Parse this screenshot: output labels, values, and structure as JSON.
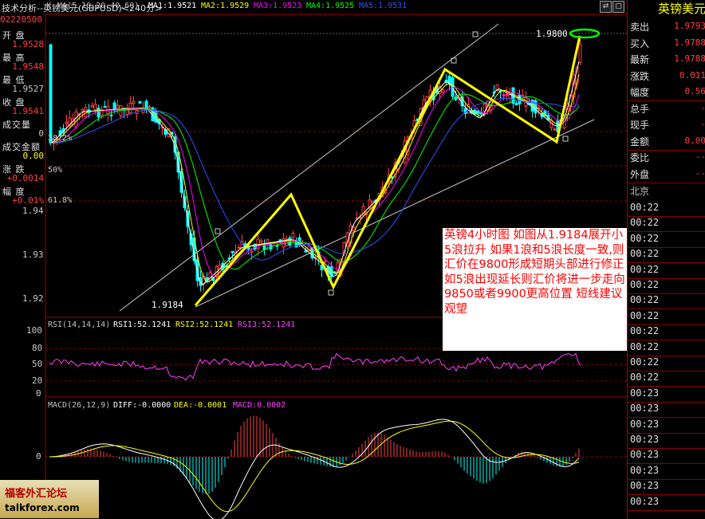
{
  "window": {
    "title": "技术分析--英镑美元(GBPUSD)<240分>",
    "controls": [
      "⇄",
      "▢",
      "▣"
    ]
  },
  "ma_header": {
    "code_k": "K",
    "ma_params": "MA(5,10,20,40,60)",
    "ma1": "MA1:1.9521",
    "ma2": "MA2:1.9529",
    "ma3": "MA3:1.9523",
    "ma4": "MA4:1.9525",
    "ma5": "MA5:1.9531"
  },
  "left_panel": {
    "date": "02220500",
    "items": [
      {
        "label": "开  盘",
        "value": "1.9528",
        "color": "#ff4040"
      },
      {
        "label": "最  高",
        "value": "1.9548",
        "color": "#ff4040"
      },
      {
        "label": "最  低",
        "value": "1.9527",
        "color": "#c8c8c8"
      },
      {
        "label": "收  盘",
        "value": "1.9541",
        "color": "#ff4040"
      },
      {
        "label": "成交量",
        "value": "0",
        "color": "#c8c8c8"
      },
      {
        "label": "成交金额",
        "value": "0.00",
        "color": "#ffff00"
      },
      {
        "label": "涨  跌",
        "value": "+0.0014",
        "color": "#ff4040"
      },
      {
        "label": "幅  度",
        "value": "+0.01%",
        "color": "#ff4040"
      }
    ]
  },
  "price_axis": [
    "1.94",
    "1.93",
    "1.92"
  ],
  "fib_labels": [
    "38.2%",
    "50%",
    "61.8%"
  ],
  "chart_labels": {
    "low_price": "1.9184",
    "high_price": "1.9800"
  },
  "rsi": {
    "header_params": "RSI(14,14,14)",
    "rsi1": "RSI1:52.1241",
    "rsi2": "RSI2:52.1241",
    "rsi3": "RSI3:52.1241",
    "axis": [
      "100",
      "80",
      "50",
      "20",
      "0"
    ]
  },
  "macd": {
    "header_params": "MACD(26,12,9)",
    "diff": "DIFF:-0.0000",
    "dea": "DEA:-0.0001",
    "macd": "MACD:0.0002",
    "axis_zero": "0"
  },
  "annotation": "英镑4小时图 如图从1.9184展开小5浪拉升 如果1浪和5浪长度一致,则汇价在9800形成短期头部进行修正 如5浪出现延长则汇价将进一步走向9850或者9900更高位置 短线建议观望",
  "right_panel": {
    "title": "英镑美元",
    "quotes": [
      {
        "label": "卖出",
        "value": "1.9793"
      },
      {
        "label": "买入",
        "value": "1.9788"
      },
      {
        "label": "最新",
        "value": "1.9788"
      },
      {
        "label": "涨跌",
        "value": "0.011"
      },
      {
        "label": "幅度",
        "value": "0.56"
      },
      {
        "label": "总手",
        "value": "-"
      },
      {
        "label": "现手",
        "value": "-"
      },
      {
        "label": "金额",
        "value": "0.00"
      },
      {
        "label": "委比",
        "value": "--"
      },
      {
        "label": "外盘",
        "value": "--"
      }
    ],
    "region": "北京",
    "times": [
      "00:22",
      "00:22",
      "00:22",
      "00:22",
      "00:22",
      "00:22",
      "00:22",
      "00:22",
      "00:22",
      "00:22",
      "00:22",
      "00:22",
      "00:23",
      "00:23",
      "00:23",
      "00:23",
      "00:23",
      "00:23",
      "00:23",
      "00:23"
    ]
  },
  "watermark": {
    "line1": "福客外汇论坛",
    "line2": "talkforex.com"
  },
  "colors": {
    "up": "#ff4040",
    "down": "#00ffff",
    "wave": "#ffff00",
    "ma1": "#ffffff",
    "ma2": "#ffff00",
    "ma3": "#ff00ff",
    "ma4": "#00ff00",
    "ma5": "#3050ff"
  }
}
